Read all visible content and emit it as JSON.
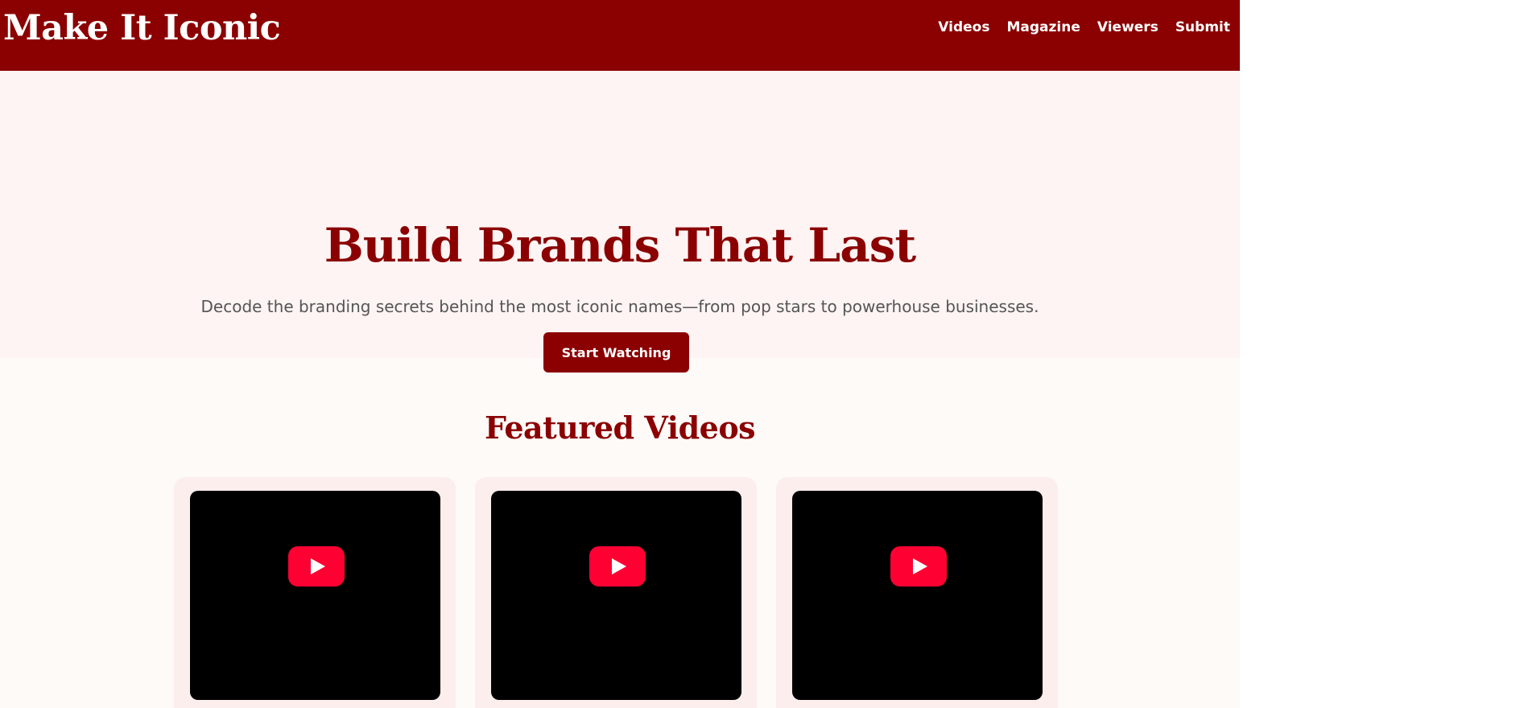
{
  "header": {
    "brand": "Make It Iconic",
    "nav": [
      "Videos",
      "Magazine",
      "Viewers",
      "Submit"
    ]
  },
  "hero": {
    "title": "Build Brands That Last",
    "subtitle": "Decode the branding secrets behind the most iconic names—from pop stars to powerhouse businesses.",
    "cta_label": "Start Watching"
  },
  "featured": {
    "title": "Featured Videos",
    "videos": [
      {
        "play_icon": "youtube-play-icon"
      },
      {
        "play_icon": "youtube-play-icon"
      },
      {
        "play_icon": "youtube-play-icon"
      }
    ]
  },
  "colors": {
    "brand_red": "#8b0000",
    "hero_bg": "#fdf4f3",
    "page_bg": "#fdfaf8",
    "card_bg": "#fdeeee",
    "play_red": "#ff0033"
  }
}
